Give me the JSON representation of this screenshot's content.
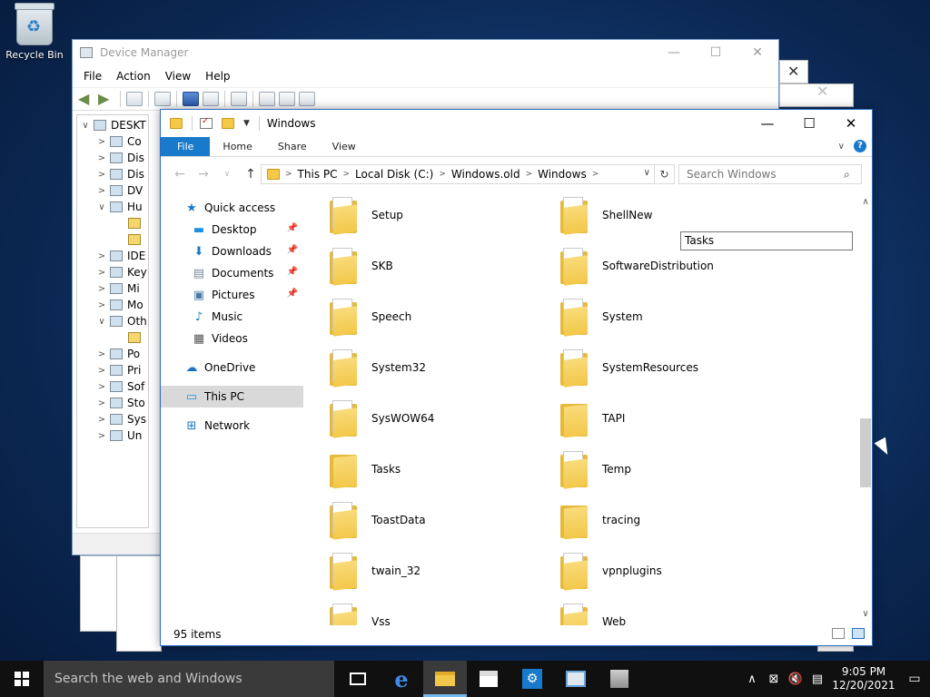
{
  "desktop": {
    "recycle_bin_label": "Recycle Bin"
  },
  "device_manager": {
    "title": "Device Manager",
    "menu": [
      "File",
      "Action",
      "View",
      "Help"
    ],
    "tree": [
      {
        "chev": "∨",
        "label": "DESKT",
        "indent": 0
      },
      {
        "chev": ">",
        "label": "Co",
        "indent": 1
      },
      {
        "chev": ">",
        "label": "Dis",
        "indent": 1
      },
      {
        "chev": ">",
        "label": "Dis",
        "indent": 1
      },
      {
        "chev": ">",
        "label": "DV",
        "indent": 1
      },
      {
        "chev": "∨",
        "label": "Hu",
        "indent": 1
      },
      {
        "chev": "",
        "label": "",
        "indent": 2
      },
      {
        "chev": "",
        "label": "",
        "indent": 2
      },
      {
        "chev": ">",
        "label": "IDE",
        "indent": 1
      },
      {
        "chev": ">",
        "label": "Key",
        "indent": 1
      },
      {
        "chev": ">",
        "label": "Mi",
        "indent": 1
      },
      {
        "chev": ">",
        "label": "Mo",
        "indent": 1
      },
      {
        "chev": "∨",
        "label": "Oth",
        "indent": 1
      },
      {
        "chev": "",
        "label": "",
        "indent": 2
      },
      {
        "chev": ">",
        "label": "Po",
        "indent": 1
      },
      {
        "chev": ">",
        "label": "Pri",
        "indent": 1
      },
      {
        "chev": ">",
        "label": "Sof",
        "indent": 1
      },
      {
        "chev": ">",
        "label": "Sto",
        "indent": 1
      },
      {
        "chev": ">",
        "label": "Sys",
        "indent": 1
      },
      {
        "chev": ">",
        "label": "Un",
        "indent": 1
      }
    ]
  },
  "explorer": {
    "title": "Windows",
    "ribbon_tabs": [
      "File",
      "Home",
      "Share",
      "View"
    ],
    "breadcrumb": [
      "This PC",
      "Local Disk (C:)",
      "Windows.old",
      "Windows"
    ],
    "search_placeholder": "Search Windows",
    "tooltip": "Tasks",
    "nav": [
      {
        "label": "Quick access",
        "icon": "star-icon",
        "glyph": "★",
        "color": "#1979ca",
        "level": 1,
        "pinned": false
      },
      {
        "label": "Desktop",
        "icon": "desktop-icon",
        "glyph": "▬",
        "color": "#1e90e0",
        "level": 2,
        "pinned": true
      },
      {
        "label": "Downloads",
        "icon": "download-icon",
        "glyph": "⬇",
        "color": "#1979ca",
        "level": 2,
        "pinned": true
      },
      {
        "label": "Documents",
        "icon": "document-icon",
        "glyph": "▤",
        "color": "#7a8a99",
        "level": 2,
        "pinned": true
      },
      {
        "label": "Pictures",
        "icon": "pictures-icon",
        "glyph": "▣",
        "color": "#4a7aa8",
        "level": 2,
        "pinned": true
      },
      {
        "label": "Music",
        "icon": "music-icon",
        "glyph": "♪",
        "color": "#1979ca",
        "level": 2,
        "pinned": false
      },
      {
        "label": "Videos",
        "icon": "video-icon",
        "glyph": "▦",
        "color": "#555555",
        "level": 2,
        "pinned": false
      },
      {
        "label": "OneDrive",
        "icon": "cloud-icon",
        "glyph": "☁",
        "color": "#1e6fc4",
        "level": 1,
        "pinned": false
      },
      {
        "label": "This PC",
        "icon": "computer-icon",
        "glyph": "▭",
        "color": "#1e90e0",
        "level": 1,
        "pinned": false,
        "selected": true
      },
      {
        "label": "Network",
        "icon": "network-icon",
        "glyph": "⊞",
        "color": "#1979ca",
        "level": 1,
        "pinned": false
      }
    ],
    "folders": [
      {
        "name": "Setup",
        "style": "paper"
      },
      {
        "name": "ShellNew",
        "style": "paper"
      },
      {
        "name": "SKB",
        "style": "paper"
      },
      {
        "name": "SoftwareDistribution",
        "style": "paper"
      },
      {
        "name": "Speech",
        "style": "paper"
      },
      {
        "name": "System",
        "style": "paper"
      },
      {
        "name": "System32",
        "style": "paper"
      },
      {
        "name": "SystemResources",
        "style": "paper"
      },
      {
        "name": "SysWOW64",
        "style": "paper"
      },
      {
        "name": "TAPI",
        "style": "plain"
      },
      {
        "name": "Tasks",
        "style": "plain"
      },
      {
        "name": "Temp",
        "style": "paper"
      },
      {
        "name": "ToastData",
        "style": "paper"
      },
      {
        "name": "tracing",
        "style": "plain"
      },
      {
        "name": "twain_32",
        "style": "paper"
      },
      {
        "name": "vpnplugins",
        "style": "paper"
      },
      {
        "name": "Vss",
        "style": "paper"
      },
      {
        "name": "Web",
        "style": "paper"
      }
    ],
    "status": "95 items"
  },
  "taskbar": {
    "search_placeholder": "Search the web and Windows",
    "time": "9:05 PM",
    "date": "12/20/2021"
  }
}
